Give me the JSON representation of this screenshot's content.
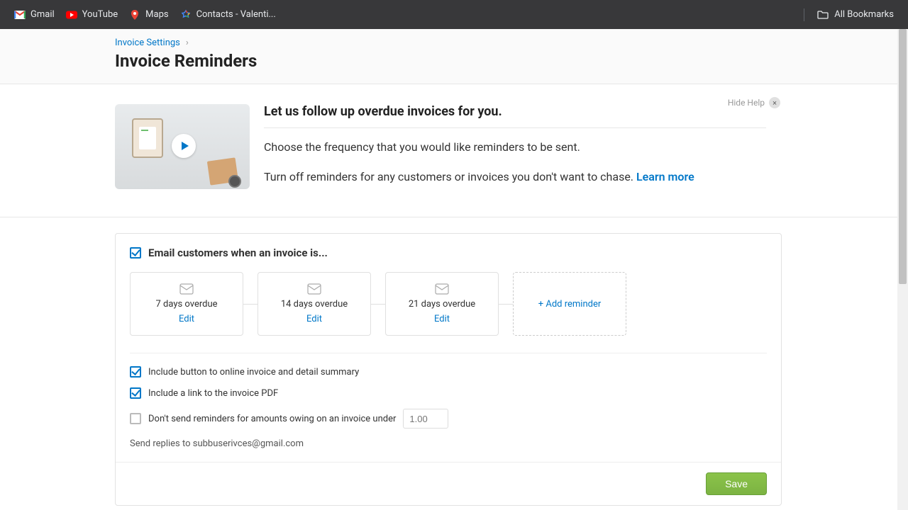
{
  "bookmarks": {
    "items": [
      {
        "label": "Gmail"
      },
      {
        "label": "YouTube"
      },
      {
        "label": "Maps"
      },
      {
        "label": "Contacts - Valenti..."
      }
    ],
    "all_bookmarks": "All Bookmarks"
  },
  "breadcrumb": {
    "parent": "Invoice Settings",
    "chevron": "›"
  },
  "page": {
    "title": "Invoice Reminders"
  },
  "help": {
    "hide_label": "Hide Help",
    "hide_x": "×",
    "heading": "Let us follow up overdue invoices for you.",
    "line1": "Choose the frequency that you would like reminders to be sent.",
    "line2_prefix": "Turn off reminders for any customers or invoices you don't want to chase. ",
    "learn_more": "Learn more"
  },
  "settings": {
    "section_label": "Email customers when an invoice is...",
    "reminders": [
      {
        "label": "7 days overdue",
        "edit": "Edit"
      },
      {
        "label": "14 days overdue",
        "edit": "Edit"
      },
      {
        "label": "21 days overdue",
        "edit": "Edit"
      }
    ],
    "add_reminder": "+ Add reminder",
    "include_button_label": "Include button to online invoice and detail summary",
    "include_pdf_label": "Include a link to the invoice PDF",
    "dont_send_label": "Don't send reminders for amounts owing on an invoice under",
    "amount_placeholder": "1.00",
    "send_replies_prefix": "Send replies to ",
    "send_replies_email": "subbuserivces@gmail.com",
    "save": "Save"
  }
}
